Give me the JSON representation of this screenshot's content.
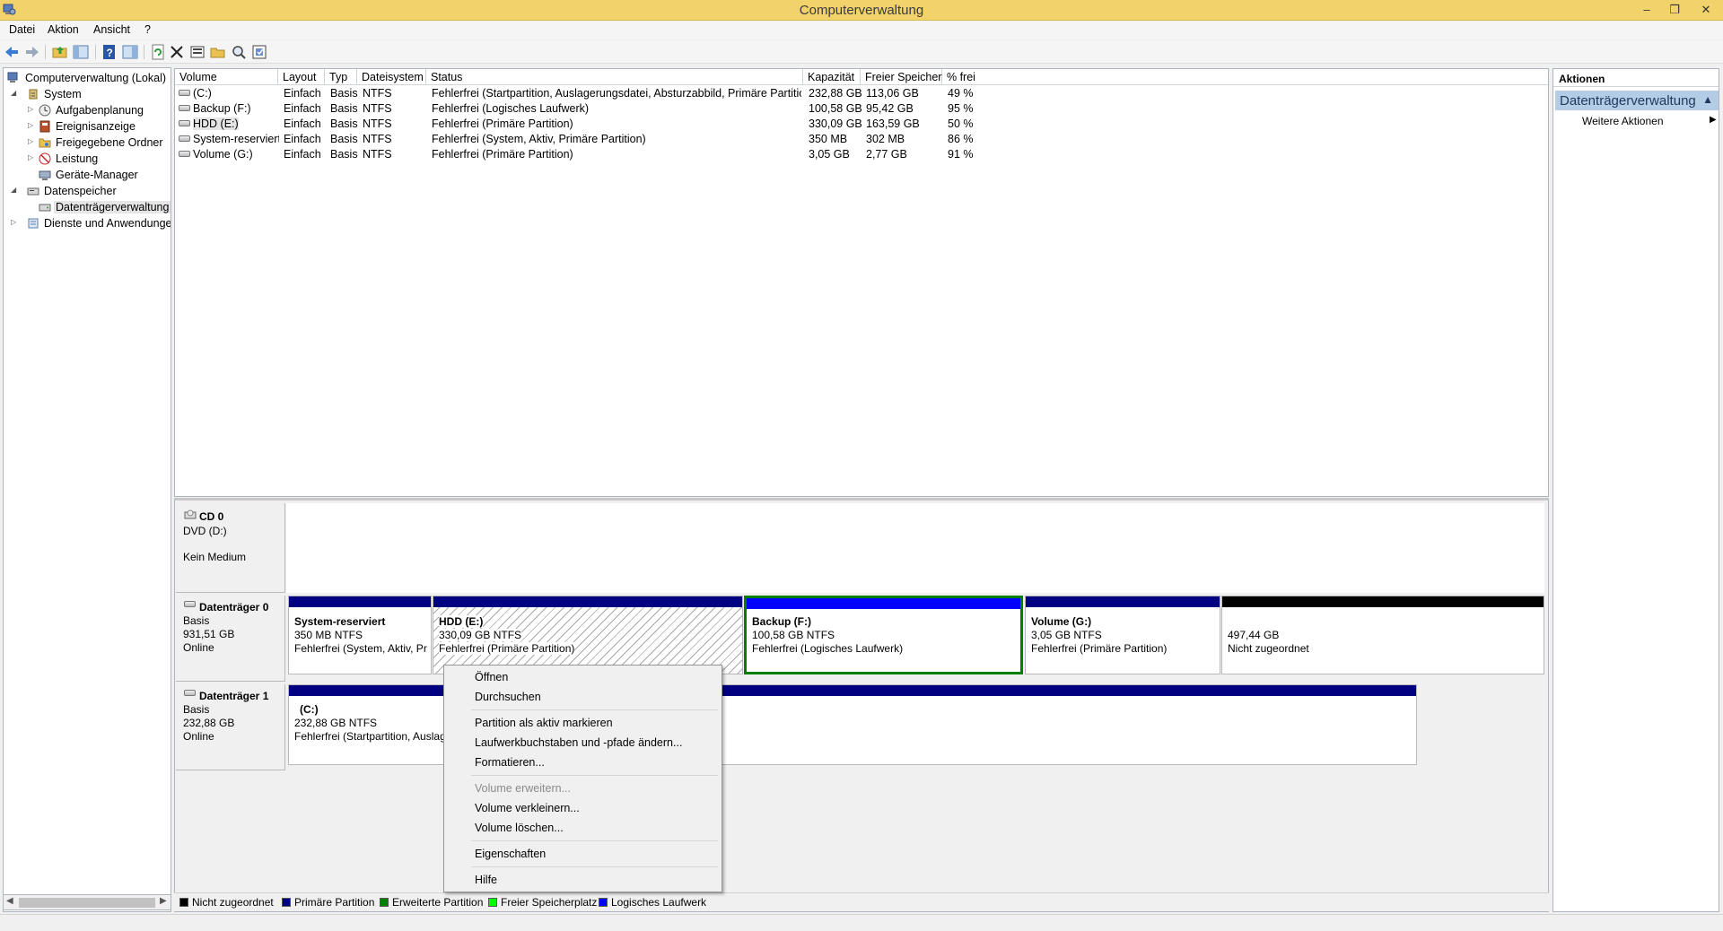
{
  "window": {
    "title": "Computerverwaltung",
    "minimize": "–",
    "restore": "❐",
    "close": "✕"
  },
  "menu": {
    "items": [
      "Datei",
      "Aktion",
      "Ansicht",
      "?"
    ]
  },
  "toolbar": {
    "icons": [
      "back-icon",
      "forward-icon",
      "up-folder-icon",
      "show-hide-tree-icon",
      "help-icon",
      "show-hide-action-pane-icon",
      "refresh-icon",
      "delete-icon",
      "properties-icon",
      "open-folder-icon",
      "search-drive-icon",
      "settings-icon"
    ]
  },
  "tree": {
    "root": "Computerverwaltung (Lokal)",
    "system": "System",
    "system_children": [
      "Aufgabenplanung",
      "Ereignisanzeige",
      "Freigegebene Ordner",
      "Leistung",
      "Geräte-Manager"
    ],
    "storage": "Datenspeicher",
    "storage_children": [
      "Datenträgerverwaltung"
    ],
    "services": "Dienste und Anwendungen"
  },
  "volume_table": {
    "columns": [
      "Volume",
      "Layout",
      "Typ",
      "Dateisystem",
      "Status",
      "Kapazität",
      "Freier Speicher",
      "% frei"
    ],
    "rows": [
      [
        "(C:)",
        "Einfach",
        "Basis",
        "NTFS",
        "Fehlerfrei (Startpartition, Auslagerungsdatei, Absturzabbild, Primäre Partition)",
        "232,88 GB",
        "113,06 GB",
        "49 %"
      ],
      [
        "Backup (F:)",
        "Einfach",
        "Basis",
        "NTFS",
        "Fehlerfrei (Logisches Laufwerk)",
        "100,58 GB",
        "95,42 GB",
        "95 %"
      ],
      [
        "HDD (E:)",
        "Einfach",
        "Basis",
        "NTFS",
        "Fehlerfrei (Primäre Partition)",
        "330,09 GB",
        "163,59 GB",
        "50 %"
      ],
      [
        "System-reserviert",
        "Einfach",
        "Basis",
        "NTFS",
        "Fehlerfrei (System, Aktiv, Primäre Partition)",
        "350 MB",
        "302 MB",
        "86 %"
      ],
      [
        "Volume (G:)",
        "Einfach",
        "Basis",
        "NTFS",
        "Fehlerfrei (Primäre Partition)",
        "3,05 GB",
        "2,77 GB",
        "91 %"
      ]
    ]
  },
  "disks": {
    "cd0": {
      "name": "CD 0",
      "line1": "DVD (D:)",
      "line2": "Kein Medium"
    },
    "disk0": {
      "name": "Datenträger 0",
      "type": "Basis",
      "size": "931,51 GB",
      "state": "Online",
      "partitions": [
        {
          "name": "System-reserviert",
          "size": "350 MB NTFS",
          "status": "Fehlerfrei (System, Aktiv, Pr"
        },
        {
          "name": "HDD  (E:)",
          "size": "330,09 GB NTFS",
          "status": "Fehlerfrei (Primäre Partition)"
        },
        {
          "name": "Backup  (F:)",
          "size": "100,58 GB NTFS",
          "status": "Fehlerfrei (Logisches Laufwerk)"
        },
        {
          "name": "Volume  (G:)",
          "size": "3,05 GB NTFS",
          "status": "Fehlerfrei (Primäre Partition)"
        },
        {
          "name": "",
          "size": "497,44 GB",
          "status": "Nicht zugeordnet"
        }
      ]
    },
    "disk1": {
      "name": "Datenträger 1",
      "type": "Basis",
      "size": "232,88 GB",
      "state": "Online",
      "partitions": [
        {
          "name": "(C:)",
          "size": "232,88 GB NTFS",
          "status": "Fehlerfrei (Startpartition, Auslag"
        }
      ]
    }
  },
  "legend": [
    {
      "label": "Nicht zugeordnet",
      "color": "#000000"
    },
    {
      "label": "Primäre Partition",
      "color": "#000080"
    },
    {
      "label": "Erweiterte Partition",
      "color": "#008000"
    },
    {
      "label": "Freier Speicherplatz",
      "color": "#00ff00"
    },
    {
      "label": "Logisches Laufwerk",
      "color": "#0000ff"
    }
  ],
  "actions": {
    "header": "Aktionen",
    "section": "Datenträgerverwaltung",
    "more": "Weitere Aktionen"
  },
  "context_menu": {
    "open": "Öffnen",
    "browse": "Durchsuchen",
    "mark_active": "Partition als aktiv markieren",
    "change_letter": "Laufwerkbuchstaben und -pfade ändern...",
    "format": "Formatieren...",
    "extend": "Volume erweitern...",
    "shrink": "Volume verkleinern...",
    "delete": "Volume löschen...",
    "properties": "Eigenschaften",
    "help": "Hilfe"
  },
  "colors": {
    "titlebar": "#f2d36b",
    "primary": "#000080",
    "logical": "#0000ff",
    "extended": "#008000",
    "unallocated": "#000000",
    "action_section": "#b5cce6"
  }
}
